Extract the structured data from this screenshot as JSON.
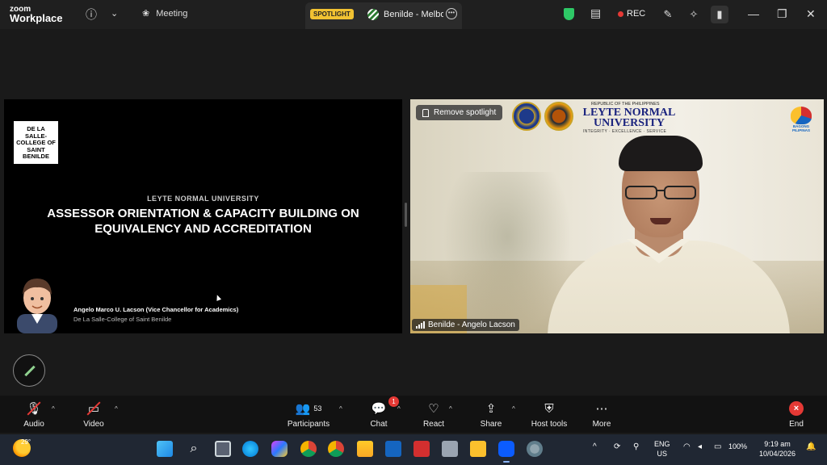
{
  "titlebar": {
    "brand_top": "zoom",
    "brand_bottom": "Workplace",
    "meeting_label": "Meeting",
    "spotlight_badge": "SPOTLIGHT",
    "tab_title": "Benilde - Melbou",
    "rec_label": "REC"
  },
  "slide": {
    "logo_text": "DE LA SALLE-COLLEGE OF SAINT BENILDE",
    "university": "LEYTE NORMAL UNIVERSITY",
    "title": "ASSESSOR ORIENTATION & CAPACITY BUILDING ON EQUIVALENCY AND ACCREDITATION",
    "speaker_name": "Angelo Marco U. Lacson (Vice Chancellor for Academics)",
    "speaker_org": "De La Salle-College of Saint Benilde"
  },
  "video": {
    "remove_spotlight": "Remove spotlight",
    "banner_republic": "REPUBLIC OF THE PHILIPPINES",
    "banner_name": "LEYTE NORMAL UNIVERSITY",
    "banner_motto": "INTEGRITY · EXCELLENCE · SERVICE",
    "banner_bagong": "BAGONG PILIPINAS",
    "participant_name": "Benilde - Angelo Lacson"
  },
  "toolbar": {
    "audio": "Audio",
    "video": "Video",
    "participants": "Participants",
    "participants_count": "53",
    "chat": "Chat",
    "chat_badge": "1",
    "react": "React",
    "share": "Share",
    "host_tools": "Host tools",
    "more": "More",
    "end": "End"
  },
  "taskbar": {
    "temperature": "29°",
    "lang_top": "ENG",
    "lang_bottom": "US",
    "battery": "100%",
    "time": "9:19 am",
    "date": "10/04/2026"
  }
}
